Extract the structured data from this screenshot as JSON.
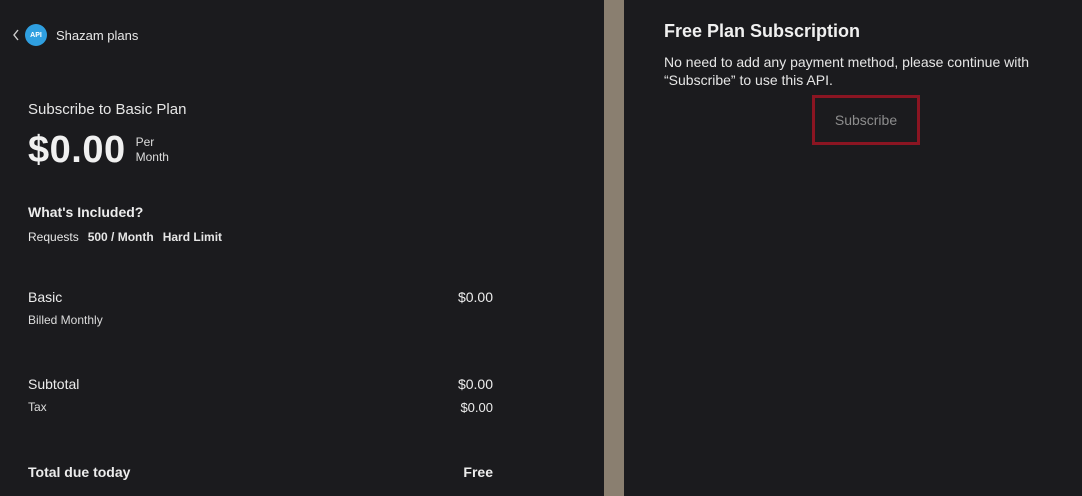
{
  "header": {
    "back_icon": "chevron-left-icon",
    "logo_icon": "api-logo-icon",
    "logo_text": "API",
    "app_name": "Shazam plans"
  },
  "plan": {
    "title": "Subscribe to Basic Plan",
    "price": "$0.00",
    "per_line1": "Per",
    "per_line2": "Month"
  },
  "included": {
    "title": "What's Included?",
    "requests_label": "Requests",
    "requests_value": "500 / Month",
    "limit": "Hard Limit"
  },
  "summary": {
    "basic_label": "Basic",
    "basic_value": "$0.00",
    "billed": "Billed Monthly",
    "subtotal_label": "Subtotal",
    "subtotal_value": "$0.00",
    "tax_label": "Tax",
    "tax_value": "$0.00",
    "total_label": "Total due today",
    "total_value": "Free"
  },
  "right": {
    "title": "Free Plan Subscription",
    "description": "No need to add any payment method, please continue with “Subscribe” to use this API.",
    "subscribe_label": "Subscribe"
  },
  "colors": {
    "background": "#1b1b1e",
    "divider": "#8a7f70",
    "highlight_border": "#8b1522",
    "logo": "#2f9fe0"
  }
}
